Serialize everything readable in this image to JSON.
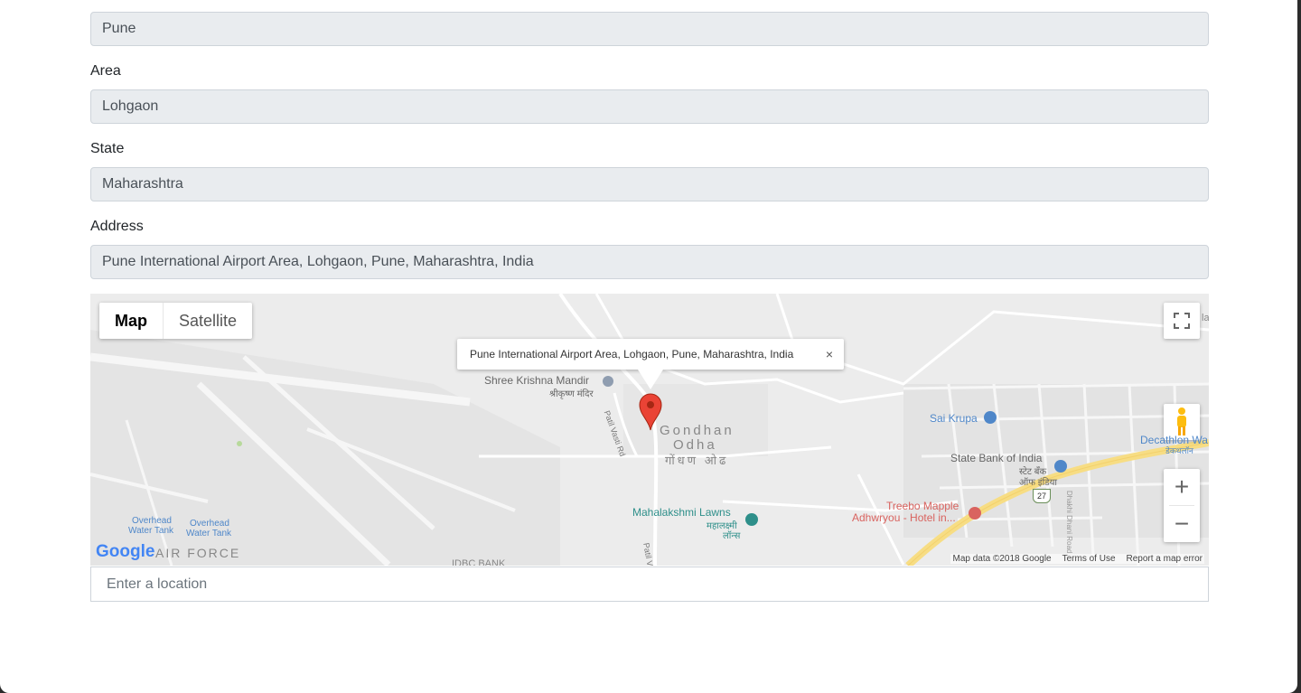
{
  "form": {
    "city_value": "Pune",
    "area_label": "Area",
    "area_value": "Lohgaon",
    "state_label": "State",
    "state_value": "Maharashtra",
    "address_label": "Address",
    "address_value": "Pune International Airport Area, Lohgaon, Pune, Maharashtra, India"
  },
  "map": {
    "type_map": "Map",
    "type_satellite": "Satellite",
    "infowindow_text": "Pune International Airport Area, Lohgaon, Pune, Maharashtra, India",
    "infowindow_close": "×",
    "places": {
      "temple": "Shree Krishna Mandir",
      "temple_local": "श्रीकृष्ण मंदिर",
      "road1": "Patil Vasti Rd",
      "area_name_1": "Gondhan",
      "area_name_2": "Odha",
      "area_local": "गोंधण ओढ",
      "sai": "Sai Krupa",
      "sbi": "State Bank of India",
      "sbi_local_1": "स्टेट बँक",
      "sbi_local_2": "ऑफ इंडिया",
      "lawns": "Mahalakshmi Lawns",
      "lawns_local_1": "महालक्ष्मी",
      "lawns_local_2": "लॉन्स",
      "hotel_1": "Treebo Mapple",
      "hotel_2": "Adhwryou - Hotel in...",
      "decathlon": "Decathlon Wa",
      "decathlon_local": "डेकथलॉन",
      "highway": "27",
      "airforce": "AIR FORCE",
      "tank1_a": "Overhead",
      "tank1_b": "Water Tank",
      "tank2_a": "Overhead",
      "tank2_b": "Water Tank",
      "idbc": "IDBC BANK",
      "road2": "Patil V",
      "road3": "Dhakhi Dhani Road",
      "edge_la": "la"
    },
    "google_logo": "Google",
    "footer": {
      "data": "Map data ©2018 Google",
      "terms": "Terms of Use",
      "report": "Report a map error"
    },
    "zoom_in": "+",
    "zoom_out": "−"
  },
  "search": {
    "placeholder": "Enter a location"
  },
  "colors": {
    "field_bg": "#e9ecef",
    "map_bg": "#ececec",
    "marker": "#ea4335",
    "poi_blue": "#4f87c9",
    "poi_red": "#d9635f",
    "highway": "#f7dd84"
  }
}
